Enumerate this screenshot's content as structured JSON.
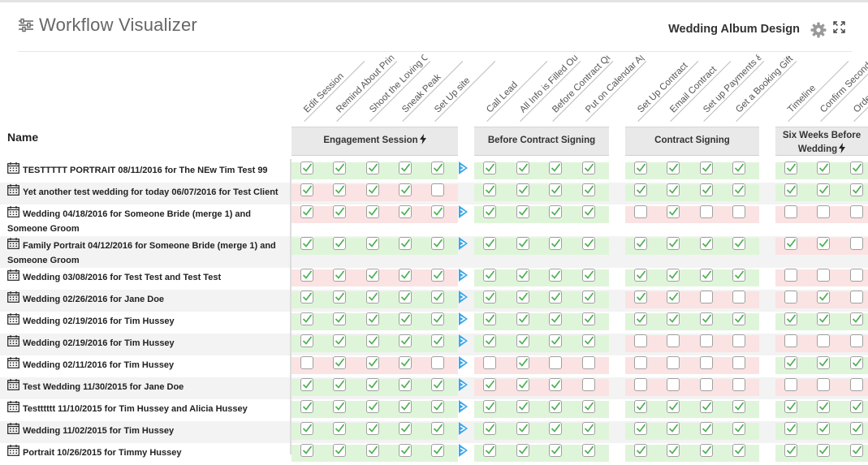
{
  "header": {
    "title": "Workflow Visualizer",
    "workflow_name": "Wedding Album Design"
  },
  "table": {
    "name_header": "Name",
    "columns": [
      "Edit Session",
      "Remind About Prints/Books",
      "Shoot the Loving Couple",
      "Sneak Peak",
      "Set Up site",
      "Call Lead",
      "All Info is Filled Out",
      "Before Contract Questionnaire",
      "Put on Calendar Approved",
      "Set Up Contract",
      "Email Contract",
      "Set up Payments & Reminders",
      "Get a Booking Gift",
      "Timeline",
      "Confirm Second Shooter",
      "Order"
    ],
    "groups": [
      {
        "label": "Engagement Session",
        "bolt": true
      },
      {
        "label": "Before Contract Signing",
        "bolt": false
      },
      {
        "label": "Contract Signing",
        "bolt": false
      },
      {
        "label": "Six Weeks Before Wedding",
        "bolt": true
      }
    ],
    "rows": [
      {
        "name": "TESTTTTT PORTRAIT 08/11/2016 for The NEw Tim Test 99",
        "tone": [
          "g",
          "g",
          "g",
          "g"
        ],
        "checks": [
          1,
          1,
          1,
          1,
          1,
          1,
          1,
          1,
          1,
          1,
          1,
          1,
          1,
          1,
          1,
          1
        ],
        "arrow": true
      },
      {
        "name": "Yet another test wedding for today 06/07/2016 for Test Client",
        "tone": [
          "r",
          "g",
          "g",
          "g"
        ],
        "checks": [
          1,
          1,
          1,
          1,
          0,
          1,
          1,
          1,
          1,
          1,
          1,
          1,
          1,
          1,
          1,
          1
        ],
        "arrow": false
      },
      {
        "name": "Wedding 04/18/2016 for Someone Bride (merge 1) and Someone Groom",
        "tone": [
          "r",
          "g",
          "r",
          "r"
        ],
        "checks": [
          1,
          1,
          1,
          1,
          1,
          1,
          1,
          1,
          1,
          0,
          1,
          0,
          0,
          0,
          0,
          0
        ],
        "arrow": true
      },
      {
        "name": "Family Portrait 04/12/2016 for Someone Bride (merge 1) and Someone Groom",
        "tone": [
          "g",
          "g",
          "g",
          "r"
        ],
        "checks": [
          1,
          1,
          1,
          1,
          1,
          1,
          1,
          1,
          1,
          1,
          1,
          1,
          1,
          1,
          1,
          0
        ],
        "arrow": true
      },
      {
        "name": "Wedding 03/08/2016 for Test Test and Test Test",
        "tone": [
          "r",
          "g",
          "g",
          "r"
        ],
        "checks": [
          1,
          1,
          1,
          1,
          1,
          1,
          1,
          1,
          1,
          1,
          1,
          1,
          1,
          0,
          0,
          0
        ],
        "arrow": true
      },
      {
        "name": "Wedding 02/26/2016 for Jane Doe",
        "tone": [
          "g",
          "g",
          "r",
          "r"
        ],
        "checks": [
          1,
          1,
          1,
          1,
          1,
          1,
          1,
          1,
          1,
          1,
          1,
          0,
          0,
          0,
          1,
          0
        ],
        "arrow": true
      },
      {
        "name": "Wedding 02/19/2016 for Tim Hussey",
        "tone": [
          "g",
          "g",
          "g",
          "g"
        ],
        "checks": [
          1,
          1,
          1,
          1,
          1,
          1,
          1,
          1,
          1,
          1,
          1,
          1,
          1,
          1,
          1,
          1
        ],
        "arrow": true
      },
      {
        "name": "Wedding 02/19/2016 for Tim Hussey",
        "tone": [
          "g",
          "g",
          "r",
          "r"
        ],
        "checks": [
          1,
          1,
          1,
          1,
          1,
          1,
          1,
          1,
          1,
          0,
          0,
          0,
          0,
          0,
          0,
          0
        ],
        "arrow": true
      },
      {
        "name": "Wedding 02/11/2016 for Tim Hussey",
        "tone": [
          "r",
          "r",
          "r",
          "g"
        ],
        "checks": [
          0,
          1,
          1,
          1,
          0,
          0,
          1,
          0,
          0,
          0,
          0,
          0,
          0,
          1,
          1,
          1
        ],
        "arrow": true
      },
      {
        "name": "Test Wedding 11/30/2015 for Jane Doe",
        "tone": [
          "g",
          "r",
          "r",
          "r"
        ],
        "checks": [
          1,
          1,
          1,
          1,
          1,
          1,
          1,
          1,
          0,
          0,
          0,
          0,
          0,
          0,
          0,
          0
        ],
        "arrow": true
      },
      {
        "name": "Testttttt 11/10/2015 for Tim Hussey and Alicia Hussey",
        "tone": [
          "g",
          "g",
          "g",
          "g"
        ],
        "checks": [
          1,
          1,
          1,
          1,
          1,
          1,
          1,
          1,
          1,
          1,
          1,
          1,
          1,
          1,
          1,
          1
        ],
        "arrow": true
      },
      {
        "name": "Wedding 11/02/2015 for Tim Hussey",
        "tone": [
          "g",
          "g",
          "g",
          "g"
        ],
        "checks": [
          1,
          1,
          1,
          1,
          1,
          1,
          1,
          1,
          1,
          1,
          1,
          1,
          1,
          1,
          1,
          1
        ],
        "arrow": true
      },
      {
        "name": "Portrait 10/26/2015 for Timmy Hussey",
        "tone": [
          "g",
          "g",
          "g",
          "g"
        ],
        "checks": [
          1,
          1,
          1,
          1,
          1,
          1,
          1,
          1,
          1,
          1,
          1,
          1,
          1,
          1,
          1,
          1
        ],
        "arrow": true
      }
    ]
  },
  "colors": {
    "done_bg": "#dff5d9",
    "pending_bg": "#fbe3e3",
    "check": "#4caf50",
    "arrow": "#3aa6e8",
    "group_bg": "#e9e9e9"
  },
  "icons": {
    "title": "sliders-icon",
    "settings": "gear-icon",
    "expand": "expand-icon",
    "row": "calendar-icon",
    "group_trigger": "bolt-icon",
    "advance": "arrow-right-icon"
  }
}
